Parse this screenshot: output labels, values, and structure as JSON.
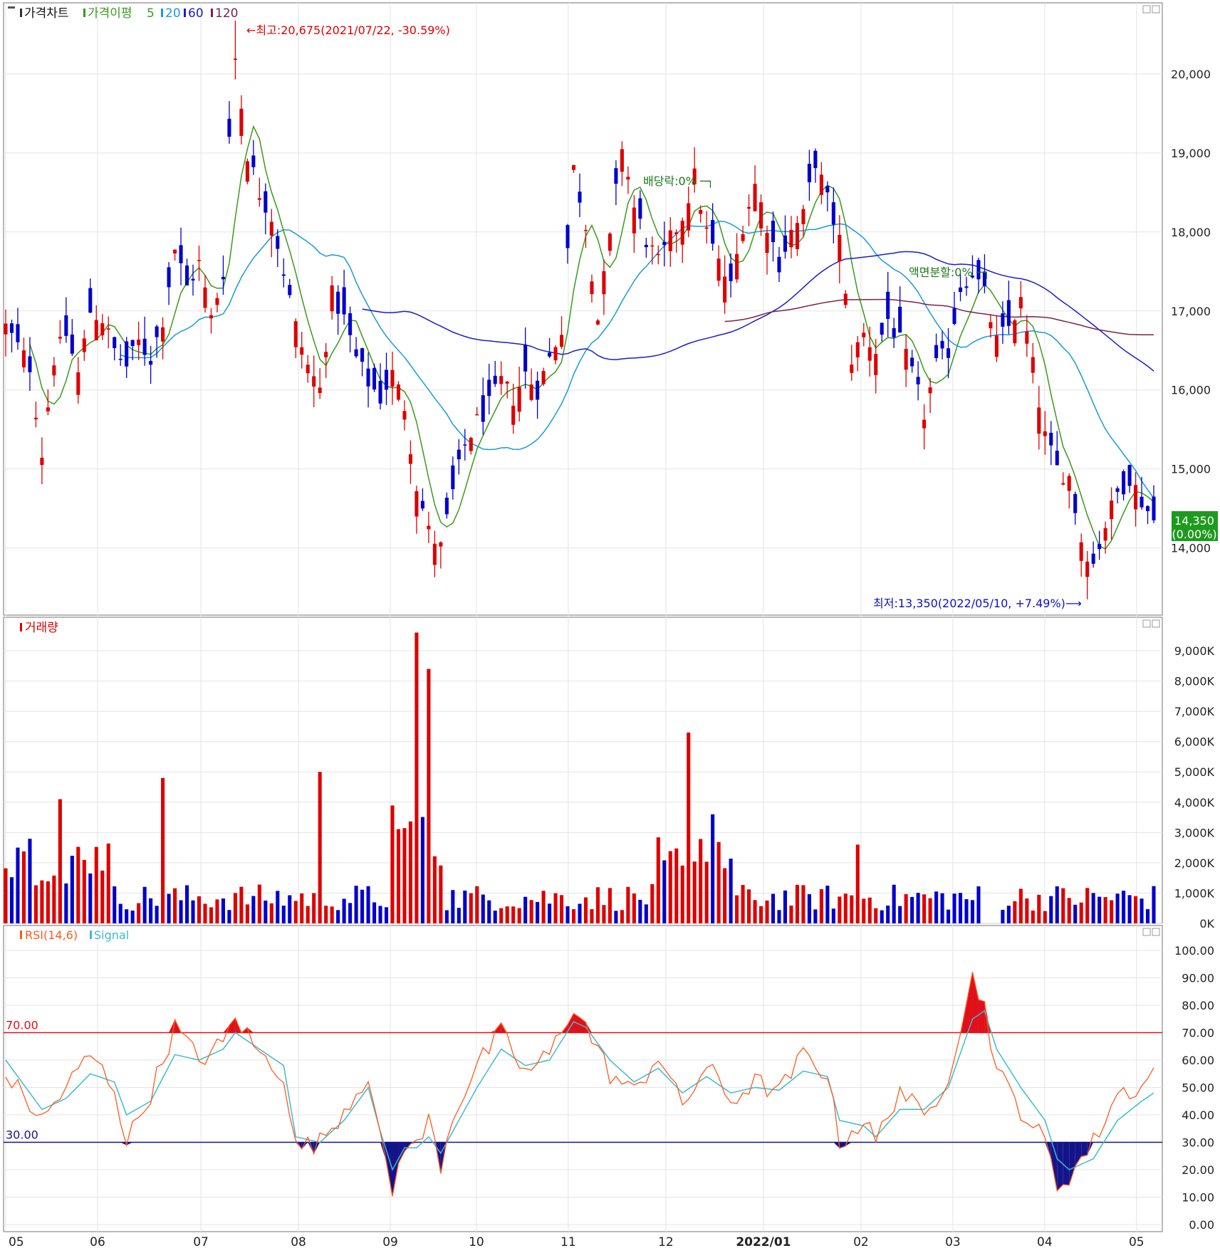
{
  "colors": {
    "up": "#dd0000",
    "down": "#0000cc",
    "ma5": "#3a9a1c",
    "ma20": "#1a9ad6",
    "ma60": "#1c1cc8",
    "ma120": "#7a2448",
    "grid": "#e4e4e4",
    "frame": "#8a8a8a",
    "rsi": "#ff5a1e",
    "signal": "#3fbad0",
    "overbought": "#e0101a",
    "oversold": "#14148a",
    "current_price_bg": "#1e9a1e",
    "high_text": "#e00000",
    "low_text": "#1010c0",
    "event_text": "#1a7a1a"
  },
  "price_panel": {
    "legend": {
      "chart_label": "가격차트",
      "ma_label": "가격이평",
      "ma5": "5",
      "ma20": "20",
      "ma60": "60",
      "ma120": "120"
    },
    "high_annotation": "←최고:20,675(2021/07/22, -30.59%)",
    "low_annotation": "최저:13,350(2022/05/10, +7.49%)⟶",
    "dividend_annotation": "배당락:0% ─┐",
    "split_annotation": "액면분할:0% ─┐",
    "current_price": "14,350",
    "current_change": "(0.00%)"
  },
  "volume_panel": {
    "legend": "거래량"
  },
  "rsi_panel": {
    "legend_rsi": "RSI(14,6)",
    "legend_signal": "Signal",
    "level_high": "70.00",
    "level_low": "30.00"
  },
  "chart_data": [
    {
      "type": "candlestick",
      "ylim": [
        13150,
        20900
      ],
      "yticks": [
        "14,000",
        "15,000",
        "16,000",
        "17,000",
        "18,000",
        "19,000",
        "20,000"
      ],
      "ytick_values": [
        14000,
        15000,
        16000,
        17000,
        18000,
        19000,
        20000
      ],
      "x_ticks": [
        "05",
        "06",
        "07",
        "08",
        "09",
        "10",
        "11",
        "12",
        "2022/01",
        "02",
        "03",
        "04",
        "05"
      ],
      "x_tick_dates": [
        "2021-05",
        "2021-06",
        "2021-07",
        "2021-08",
        "2021-09",
        "2021-10",
        "2021-11",
        "2021-12",
        "2022-01",
        "2022-02",
        "2022-03",
        "2022-04",
        "2022-05"
      ],
      "high": {
        "value": 20675,
        "date": "2021/07/22"
      },
      "low": {
        "value": 13350,
        "date": "2022/05/10"
      },
      "last_close": 14350,
      "close_series_approx": [
        [
          0,
          16800
        ],
        [
          4,
          16300
        ],
        [
          6,
          15200
        ],
        [
          8,
          16400
        ],
        [
          10,
          16700
        ],
        [
          12,
          16200
        ],
        [
          14,
          17000
        ],
        [
          16,
          16900
        ],
        [
          18,
          16500
        ],
        [
          20,
          16300
        ],
        [
          22,
          16600
        ],
        [
          24,
          16400
        ],
        [
          26,
          16900
        ],
        [
          28,
          17800
        ],
        [
          30,
          17300
        ],
        [
          32,
          17600
        ],
        [
          34,
          16900
        ],
        [
          36,
          17500
        ],
        [
          37,
          19200
        ],
        [
          38,
          20200
        ],
        [
          40,
          19000
        ],
        [
          42,
          18500
        ],
        [
          44,
          18200
        ],
        [
          46,
          17500
        ],
        [
          48,
          16800
        ],
        [
          50,
          16300
        ],
        [
          52,
          16000
        ],
        [
          54,
          17200
        ],
        [
          56,
          16900
        ],
        [
          58,
          16400
        ],
        [
          60,
          16100
        ],
        [
          62,
          15900
        ],
        [
          64,
          16200
        ],
        [
          66,
          15800
        ],
        [
          68,
          14800
        ],
        [
          70,
          14200
        ],
        [
          72,
          14000
        ],
        [
          74,
          14700
        ],
        [
          76,
          15300
        ],
        [
          78,
          15600
        ],
        [
          80,
          15800
        ],
        [
          82,
          16100
        ],
        [
          84,
          15900
        ],
        [
          86,
          16200
        ],
        [
          88,
          16000
        ],
        [
          90,
          16400
        ],
        [
          92,
          16800
        ],
        [
          94,
          18800
        ],
        [
          96,
          18100
        ],
        [
          98,
          16900
        ],
        [
          100,
          17900
        ],
        [
          102,
          19100
        ],
        [
          104,
          18300
        ],
        [
          106,
          17900
        ],
        [
          108,
          17600
        ],
        [
          110,
          17900
        ],
        [
          112,
          18200
        ],
        [
          114,
          18700
        ],
        [
          116,
          18000
        ],
        [
          118,
          17600
        ],
        [
          120,
          17300
        ],
        [
          122,
          18100
        ],
        [
          124,
          18600
        ],
        [
          126,
          18100
        ],
        [
          128,
          17600
        ],
        [
          130,
          18000
        ],
        [
          132,
          18200
        ],
        [
          134,
          18900
        ],
        [
          136,
          18400
        ],
        [
          138,
          17900
        ],
        [
          140,
          16400
        ],
        [
          142,
          16700
        ],
        [
          144,
          16500
        ],
        [
          146,
          16900
        ],
        [
          148,
          16600
        ],
        [
          150,
          16200
        ],
        [
          152,
          15700
        ],
        [
          154,
          16300
        ],
        [
          156,
          16500
        ],
        [
          158,
          17300
        ],
        [
          160,
          17500
        ],
        [
          162,
          17200
        ],
        [
          164,
          16600
        ],
        [
          166,
          16800
        ],
        [
          168,
          17100
        ],
        [
          170,
          16300
        ],
        [
          172,
          15400
        ],
        [
          174,
          15000
        ],
        [
          176,
          14900
        ],
        [
          178,
          14100
        ],
        [
          180,
          13800
        ],
        [
          182,
          14300
        ],
        [
          184,
          14700
        ],
        [
          186,
          14900
        ],
        [
          188,
          14600
        ],
        [
          190,
          14350
        ]
      ]
    },
    {
      "type": "bar",
      "title": "거래량",
      "ylim": [
        0,
        9800
      ],
      "yticks": [
        "0K",
        "1,000K",
        "2,000K",
        "3,000K",
        "4,000K",
        "5,000K",
        "6,000K",
        "7,000K",
        "8,000K",
        "9,000K"
      ],
      "ytick_values": [
        0,
        1000,
        2000,
        3000,
        4000,
        5000,
        6000,
        7000,
        8000,
        9000
      ],
      "spikes_approx": [
        {
          "date": "2021-05",
          "value": 4100
        },
        {
          "date": "2021-06",
          "value": 4800
        },
        {
          "date": "2021-07",
          "value": 5000
        },
        {
          "date": "2021-07/22",
          "value": 9600
        },
        {
          "date": "2021-07",
          "value": 8400
        },
        {
          "date": "2021-11",
          "value": 6300
        },
        {
          "date": "2021-11",
          "value": 3600
        },
        {
          "date": "2022-01",
          "value": 2600
        }
      ]
    },
    {
      "type": "line",
      "title": "RSI(14,6)",
      "ylim": [
        0,
        100
      ],
      "yticks": [
        "0.00",
        "10.00",
        "20.00",
        "30.00",
        "40.00",
        "50.00",
        "60.00",
        "70.00",
        "80.00",
        "90.00",
        "100.00"
      ],
      "ytick_values": [
        0,
        10,
        20,
        30,
        40,
        50,
        60,
        70,
        80,
        90,
        100
      ],
      "levels": [
        70,
        30
      ],
      "series": [
        {
          "name": "RSI(14,6)",
          "values_approx": [
            [
              0,
              55
            ],
            [
              6,
              38
            ],
            [
              10,
              50
            ],
            [
              14,
              62
            ],
            [
              18,
              50
            ],
            [
              20,
              30
            ],
            [
              24,
              48
            ],
            [
              28,
              72
            ],
            [
              32,
              60
            ],
            [
              36,
              66
            ],
            [
              38,
              76
            ],
            [
              42,
              62
            ],
            [
              46,
              55
            ],
            [
              48,
              28
            ],
            [
              52,
              30
            ],
            [
              56,
              42
            ],
            [
              60,
              55
            ],
            [
              62,
              30
            ],
            [
              64,
              12
            ],
            [
              66,
              30
            ],
            [
              68,
              28
            ],
            [
              70,
              38
            ],
            [
              72,
              22
            ],
            [
              74,
              40
            ],
            [
              78,
              58
            ],
            [
              82,
              70
            ],
            [
              86,
              55
            ],
            [
              90,
              62
            ],
            [
              94,
              80
            ],
            [
              96,
              72
            ],
            [
              100,
              55
            ],
            [
              104,
              48
            ],
            [
              108,
              62
            ],
            [
              112,
              43
            ],
            [
              116,
              58
            ],
            [
              120,
              45
            ],
            [
              124,
              52
            ],
            [
              128,
              48
            ],
            [
              132,
              62
            ],
            [
              136,
              55
            ],
            [
              138,
              30
            ],
            [
              142,
              38
            ],
            [
              144,
              30
            ],
            [
              148,
              50
            ],
            [
              152,
              38
            ],
            [
              156,
              55
            ],
            [
              160,
              90
            ],
            [
              162,
              80
            ],
            [
              164,
              56
            ],
            [
              168,
              42
            ],
            [
              172,
              30
            ],
            [
              174,
              14
            ],
            [
              176,
              18
            ],
            [
              180,
              30
            ],
            [
              184,
              48
            ],
            [
              188,
              50
            ],
            [
              190,
              56
            ]
          ]
        },
        {
          "name": "Signal",
          "values_approx": [
            [
              0,
              60
            ],
            [
              6,
              42
            ],
            [
              10,
              46
            ],
            [
              14,
              55
            ],
            [
              18,
              52
            ],
            [
              20,
              40
            ],
            [
              24,
              45
            ],
            [
              28,
              62
            ],
            [
              32,
              60
            ],
            [
              36,
              64
            ],
            [
              38,
              70
            ],
            [
              42,
              64
            ],
            [
              46,
              58
            ],
            [
              48,
              32
            ],
            [
              52,
              30
            ],
            [
              56,
              38
            ],
            [
              60,
              50
            ],
            [
              62,
              34
            ],
            [
              64,
              20
            ],
            [
              66,
              28
            ],
            [
              68,
              28
            ],
            [
              70,
              32
            ],
            [
              72,
              26
            ],
            [
              74,
              34
            ],
            [
              78,
              50
            ],
            [
              82,
              64
            ],
            [
              86,
              58
            ],
            [
              90,
              60
            ],
            [
              94,
              74
            ],
            [
              96,
              72
            ],
            [
              100,
              60
            ],
            [
              104,
              52
            ],
            [
              108,
              57
            ],
            [
              112,
              48
            ],
            [
              116,
              54
            ],
            [
              120,
              48
            ],
            [
              124,
              50
            ],
            [
              128,
              49
            ],
            [
              132,
              56
            ],
            [
              136,
              54
            ],
            [
              138,
              38
            ],
            [
              142,
              36
            ],
            [
              144,
              32
            ],
            [
              148,
              42
            ],
            [
              152,
              42
            ],
            [
              156,
              50
            ],
            [
              160,
              75
            ],
            [
              162,
              78
            ],
            [
              164,
              64
            ],
            [
              168,
              50
            ],
            [
              172,
              38
            ],
            [
              174,
              24
            ],
            [
              176,
              20
            ],
            [
              180,
              24
            ],
            [
              184,
              38
            ],
            [
              188,
              45
            ],
            [
              190,
              48
            ]
          ]
        }
      ]
    }
  ]
}
